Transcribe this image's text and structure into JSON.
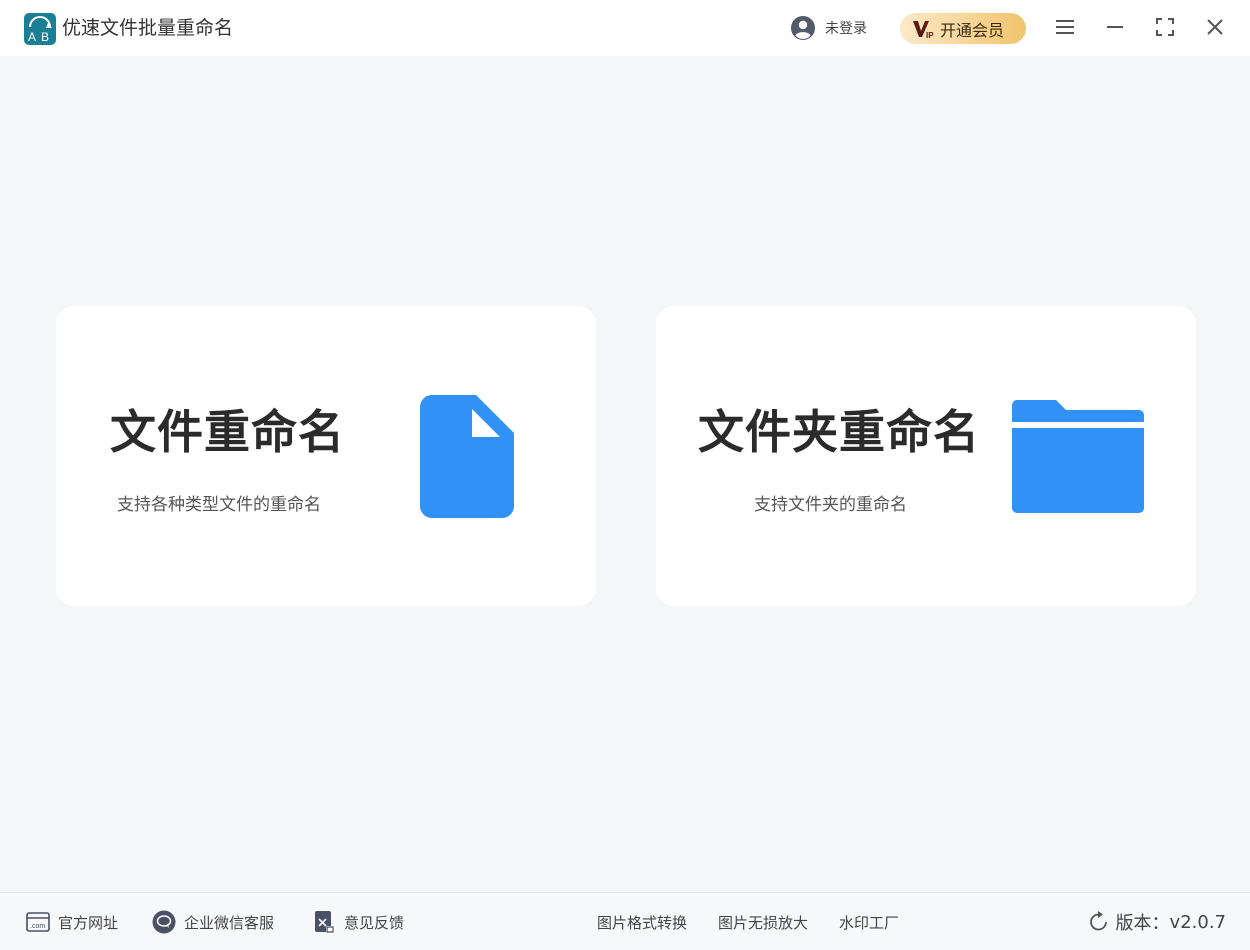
{
  "app": {
    "title": "优速文件批量重命名",
    "logo_letters": "AB"
  },
  "header": {
    "login_label": "未登录",
    "vip_label": "开通会员",
    "vip_badge": "VIP",
    "icons": {
      "user": "user-circle-icon",
      "menu": "hamburger-menu-icon",
      "minimize": "minimize-icon",
      "maximize": "maximize-icon",
      "close": "close-icon"
    }
  },
  "cards": {
    "file": {
      "title": "文件重命名",
      "subtitle": "支持各种类型文件的重命名",
      "icon": "file-icon"
    },
    "folder": {
      "title": "文件夹重命名",
      "subtitle": "支持文件夹的重命名",
      "icon": "folder-icon"
    }
  },
  "footer": {
    "website": "官方网址",
    "wechat_support": "企业微信客服",
    "feedback": "意见反馈",
    "links": [
      "图片格式转换",
      "图片无损放大",
      "水印工厂"
    ],
    "version_label": "版本：",
    "version_value": "v2.0.7"
  },
  "colors": {
    "accent": "#3191f5",
    "background": "#f5f6f8",
    "card": "#ffffff",
    "vip_gold": "#f7d597",
    "logo_teal": "#1e8aa0"
  }
}
